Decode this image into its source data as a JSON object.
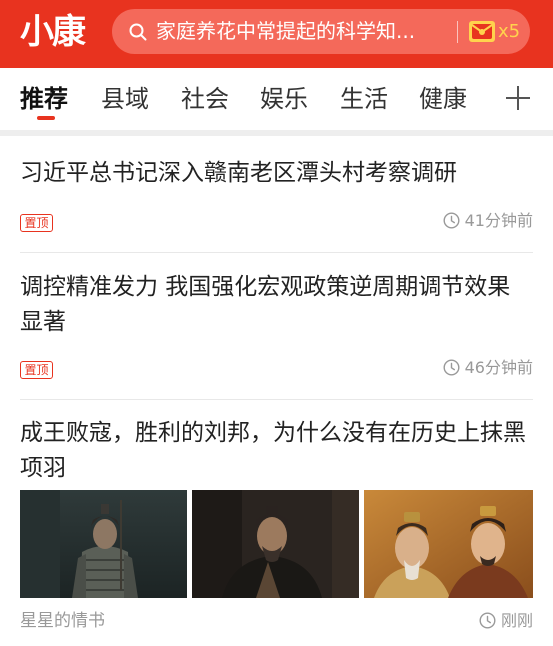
{
  "app": {
    "logo_text": "小康"
  },
  "search": {
    "placeholder": "家庭养花中常提起的科学知...",
    "coupon_count": "x5"
  },
  "tabs": [
    {
      "label": "推荐",
      "active": true
    },
    {
      "label": "县域"
    },
    {
      "label": "社会"
    },
    {
      "label": "娱乐"
    },
    {
      "label": "生活"
    },
    {
      "label": "健康"
    }
  ],
  "feed": [
    {
      "title": "习近平总书记深入赣南老区潭头村考察调研",
      "badge": "置顶",
      "time": "41分钟前"
    },
    {
      "title": "调控精准发力 我国强化宏观政策逆周期调节效果显著",
      "badge": "置顶",
      "time": "46分钟前"
    },
    {
      "title": "成王败寇，胜利的刘邦，为什么没有在历史上抹黑项羽",
      "source": "星星的情书",
      "time": "刚刚",
      "images": [
        "armored-warrior-photo",
        "elderly-official-photo",
        "two-emperors-photo"
      ]
    }
  ],
  "colors": {
    "brand": "#e8331f",
    "coupon": "#ffd34d",
    "meta": "#999999"
  }
}
